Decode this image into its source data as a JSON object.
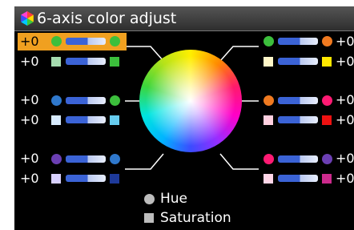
{
  "title": "6-axis color adjust",
  "legend": {
    "hue_label": "Hue",
    "saturation_label": "Saturation"
  },
  "rows": [
    {
      "value": "+0",
      "selected": true
    },
    {
      "value": "+0"
    },
    {
      "value": "+0"
    },
    {
      "value": "+0"
    },
    {
      "value": "+0"
    },
    {
      "value": "+0"
    },
    {
      "value": "+0"
    },
    {
      "value": "+0"
    },
    {
      "value": "+0"
    },
    {
      "value": "+0"
    },
    {
      "value": "+0"
    },
    {
      "value": "+0"
    }
  ],
  "colors": {
    "selection": "#f0a020",
    "green": "#3cbf3c",
    "light_green": "#a6dcb0",
    "blue": "#2f78cc",
    "light_blue": "#d8ecff",
    "cyan": "#66ccee",
    "purple": "#6b3fb3",
    "light_purple": "#d8d0ff",
    "dark_blue": "#1e3a9a",
    "orange": "#f07a20",
    "yellow": "#ffe800",
    "pink": "#ff1a73",
    "light_pink": "#ffd0e0",
    "red": "#ee1111",
    "magenta": "#cc2a8c"
  }
}
